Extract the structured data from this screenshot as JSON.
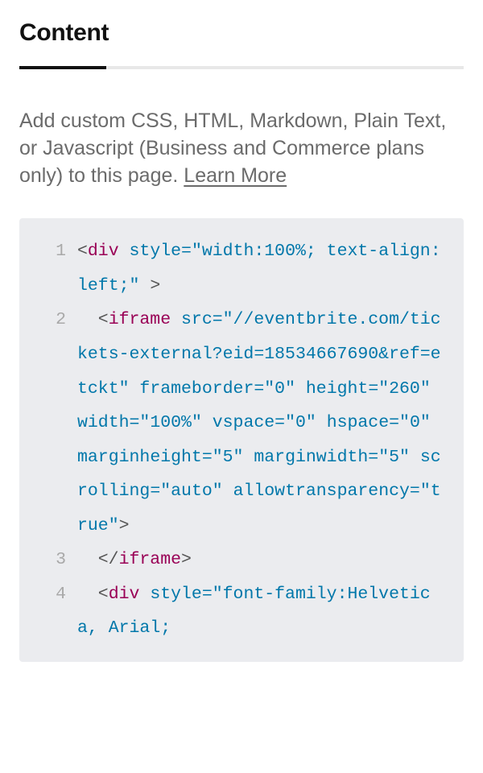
{
  "tab": {
    "title": "Content"
  },
  "description": {
    "text": "Add custom CSS, HTML, Markdown, Plain Text, or Javascript (Business and Commerce plans only) to this page. ",
    "learn_more": "Learn More"
  },
  "code": {
    "lines": [
      {
        "n": "1",
        "indent": 0,
        "tokens": [
          {
            "t": "angle",
            "v": "<"
          },
          {
            "t": "tag-name",
            "v": "div"
          },
          {
            "t": "plain",
            "v": " "
          },
          {
            "t": "attr-name",
            "v": "style"
          },
          {
            "t": "attr-eq",
            "v": "="
          },
          {
            "t": "quote",
            "v": "\""
          },
          {
            "t": "attr-value",
            "v": "width:100%; text-align: left;"
          },
          {
            "t": "quote",
            "v": "\""
          },
          {
            "t": "plain",
            "v": " "
          },
          {
            "t": "angle",
            "v": ">"
          }
        ]
      },
      {
        "n": "2",
        "indent": 2,
        "tokens": [
          {
            "t": "angle",
            "v": "<"
          },
          {
            "t": "tag-name",
            "v": "iframe"
          },
          {
            "t": "plain",
            "v": " "
          },
          {
            "t": "attr-name",
            "v": "src"
          },
          {
            "t": "attr-eq",
            "v": "="
          },
          {
            "t": "quote",
            "v": "\""
          },
          {
            "t": "attr-value",
            "v": "//eventbrite.com/tickets-external?eid=18534667690&ref=etckt"
          },
          {
            "t": "quote",
            "v": "\""
          },
          {
            "t": "plain",
            "v": " "
          },
          {
            "t": "attr-name",
            "v": "frameborder"
          },
          {
            "t": "attr-eq",
            "v": "="
          },
          {
            "t": "quote",
            "v": "\""
          },
          {
            "t": "attr-value",
            "v": "0"
          },
          {
            "t": "quote",
            "v": "\""
          },
          {
            "t": "plain",
            "v": " "
          },
          {
            "t": "attr-name",
            "v": "height"
          },
          {
            "t": "attr-eq",
            "v": "="
          },
          {
            "t": "quote",
            "v": "\""
          },
          {
            "t": "attr-value",
            "v": "260"
          },
          {
            "t": "quote",
            "v": "\""
          },
          {
            "t": "plain",
            "v": " "
          },
          {
            "t": "attr-name",
            "v": "width"
          },
          {
            "t": "attr-eq",
            "v": "="
          },
          {
            "t": "quote",
            "v": "\""
          },
          {
            "t": "attr-value",
            "v": "100%"
          },
          {
            "t": "quote",
            "v": "\""
          },
          {
            "t": "plain",
            "v": " "
          },
          {
            "t": "attr-name",
            "v": "vspace"
          },
          {
            "t": "attr-eq",
            "v": "="
          },
          {
            "t": "quote",
            "v": "\""
          },
          {
            "t": "attr-value",
            "v": "0"
          },
          {
            "t": "quote",
            "v": "\""
          },
          {
            "t": "plain",
            "v": " "
          },
          {
            "t": "attr-name",
            "v": "hspace"
          },
          {
            "t": "attr-eq",
            "v": "="
          },
          {
            "t": "quote",
            "v": "\""
          },
          {
            "t": "attr-value",
            "v": "0"
          },
          {
            "t": "quote",
            "v": "\""
          },
          {
            "t": "plain",
            "v": " "
          },
          {
            "t": "attr-name",
            "v": "marginheight"
          },
          {
            "t": "attr-eq",
            "v": "="
          },
          {
            "t": "quote",
            "v": "\""
          },
          {
            "t": "attr-value",
            "v": "5"
          },
          {
            "t": "quote",
            "v": "\""
          },
          {
            "t": "plain",
            "v": " "
          },
          {
            "t": "attr-name",
            "v": "marginwidth"
          },
          {
            "t": "attr-eq",
            "v": "="
          },
          {
            "t": "quote",
            "v": "\""
          },
          {
            "t": "attr-value",
            "v": "5"
          },
          {
            "t": "quote",
            "v": "\""
          },
          {
            "t": "plain",
            "v": " "
          },
          {
            "t": "attr-name",
            "v": "scrolling"
          },
          {
            "t": "attr-eq",
            "v": "="
          },
          {
            "t": "quote",
            "v": "\""
          },
          {
            "t": "attr-value",
            "v": "auto"
          },
          {
            "t": "quote",
            "v": "\""
          },
          {
            "t": "plain",
            "v": " "
          },
          {
            "t": "attr-name",
            "v": "allowtransparency"
          },
          {
            "t": "attr-eq",
            "v": "="
          },
          {
            "t": "quote",
            "v": "\""
          },
          {
            "t": "attr-value",
            "v": "true"
          },
          {
            "t": "quote",
            "v": "\""
          },
          {
            "t": "angle",
            "v": ">"
          }
        ]
      },
      {
        "n": "3",
        "indent": 2,
        "tokens": [
          {
            "t": "angle",
            "v": "</"
          },
          {
            "t": "tag-name",
            "v": "iframe"
          },
          {
            "t": "angle",
            "v": ">"
          }
        ]
      },
      {
        "n": "4",
        "indent": 2,
        "tokens": [
          {
            "t": "angle",
            "v": "<"
          },
          {
            "t": "tag-name",
            "v": "div"
          },
          {
            "t": "plain",
            "v": " "
          },
          {
            "t": "attr-name",
            "v": "style"
          },
          {
            "t": "attr-eq",
            "v": "="
          },
          {
            "t": "quote",
            "v": "\""
          },
          {
            "t": "attr-value",
            "v": "font-family:Helvetica, Arial;"
          }
        ]
      }
    ]
  }
}
